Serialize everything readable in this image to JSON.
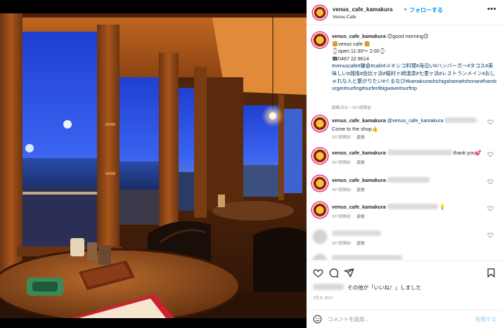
{
  "photo": {
    "alt_icon": "cafe-interior-photo"
  },
  "header": {
    "username": "venus_cafe_kamakura",
    "separator": "•",
    "follow_label": "フォローする",
    "location": "Venus Cafe",
    "more_label": "•••"
  },
  "caption": {
    "username": "venus_cafe_kamakura",
    "line1": " 😊good morning😊",
    "line2": "🍔venus cafe 🍔",
    "line3": "⌚open 11:30〜 2:00⌚",
    "line4": "☎0467 22 8614",
    "hashtags": "#venuscafe#鎌倉#cafe#メキシコ料理#海沿い#ハンバーガー#タコス#美味しい#湘南#由比ヶ浜#稲村ヶ崎温泉#七里ヶ浜#レストランメイン#おしゃれな人と繋がりたい#ぐるなび#kamakurashichigahama#shonan#hamburger#surfing#surfer#bigwave#surftrip",
    "meta": "編集済み・307週間前"
  },
  "comments": [
    {
      "username": "venus_cafe_kamakura",
      "mention": "@venus_cafe_kamakura",
      "text": "Come to the shop👍",
      "time": "307週間前",
      "reply": "返信"
    },
    {
      "username": "venus_cafe_kamakura",
      "text": "thank you💕",
      "time": "307週間前",
      "reply": "返信"
    },
    {
      "username": "venus_cafe_kamakura",
      "text": "",
      "time": "307週間前",
      "reply": "返信"
    },
    {
      "username": "venus_cafe_kamakura",
      "text": "💡",
      "time": "307週間前",
      "reply": "返信"
    },
    {
      "username": "",
      "text": "",
      "time": "307週間前",
      "reply": "返信"
    }
  ],
  "likes": {
    "text": " その他が「いいね！」しました"
  },
  "date": "7月 8, 2017",
  "add_comment": {
    "placeholder": "コメントを追加...",
    "post_label": "投稿する"
  },
  "colors": {
    "accent": "#0095f6",
    "text": "#262626",
    "muted": "#8e8e8e",
    "link": "#00376b",
    "post_disabled": "#b2dffc"
  }
}
